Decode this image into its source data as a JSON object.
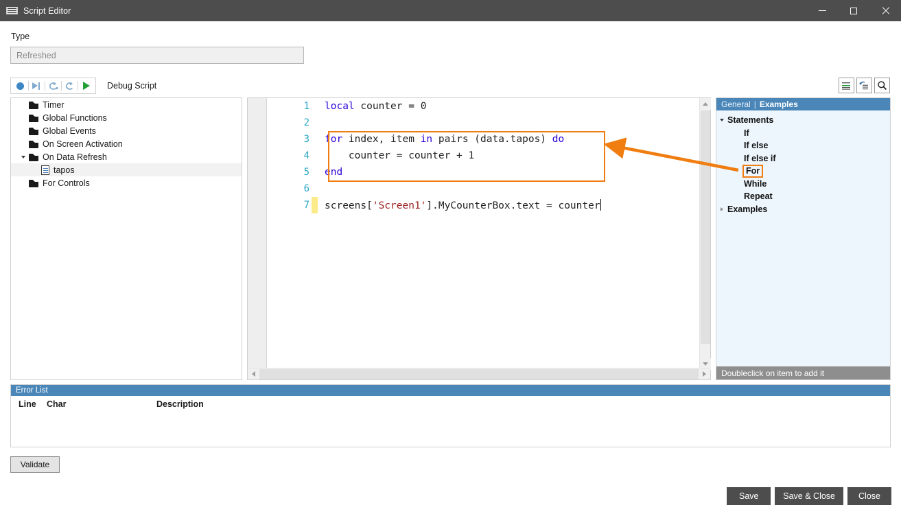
{
  "window": {
    "title": "Script Editor",
    "icon": "script-editor-icon",
    "minimize": "minimize-icon",
    "maximize": "maximize-icon",
    "close": "close-icon"
  },
  "type_field": {
    "label": "Type",
    "value": "Refreshed",
    "placeholder": "Refreshed"
  },
  "debug_toolbar": {
    "label": "Debug Script",
    "buttons": [
      {
        "name": "record-breakpoint-icon",
        "tooltip": "Breakpoint"
      },
      {
        "name": "run-to-end-icon",
        "tooltip": "Run to end"
      },
      {
        "name": "step-over-icon",
        "tooltip": "Step over"
      },
      {
        "name": "step-into-icon",
        "tooltip": "Step into"
      },
      {
        "name": "run-icon",
        "tooltip": "Run"
      }
    ]
  },
  "format_toolbar": {
    "buttons": [
      {
        "name": "format-code-icon",
        "tooltip": "Format"
      },
      {
        "name": "undo-format-icon",
        "tooltip": "Undo format"
      },
      {
        "name": "search-icon",
        "tooltip": "Find"
      }
    ]
  },
  "tree": {
    "items": [
      {
        "label": "Timer",
        "icon": "folder-icon",
        "indent": 0,
        "expander": "none",
        "selected": false
      },
      {
        "label": "Global Functions",
        "icon": "folder-icon",
        "indent": 0,
        "expander": "none",
        "selected": false
      },
      {
        "label": "Global Events",
        "icon": "folder-icon",
        "indent": 0,
        "expander": "none",
        "selected": false
      },
      {
        "label": "On Screen Activation",
        "icon": "folder-icon",
        "indent": 0,
        "expander": "none",
        "selected": false
      },
      {
        "label": "On Data Refresh",
        "icon": "folder-icon",
        "indent": 0,
        "expander": "expanded",
        "selected": false
      },
      {
        "label": "tapos",
        "icon": "document-icon",
        "indent": 1,
        "expander": "none",
        "selected": true
      },
      {
        "label": "For Controls",
        "icon": "folder-icon",
        "indent": 0,
        "expander": "none",
        "selected": false
      }
    ]
  },
  "editor": {
    "lines": [
      {
        "num": "1",
        "changed": false,
        "tokens": [
          {
            "t": "local",
            "c": "kw"
          },
          {
            "t": " counter = ",
            "c": ""
          },
          {
            "t": "0",
            "c": "num"
          }
        ]
      },
      {
        "num": "2",
        "changed": false,
        "tokens": []
      },
      {
        "num": "3",
        "changed": false,
        "tokens": [
          {
            "t": "for",
            "c": "kw"
          },
          {
            "t": " index, item ",
            "c": ""
          },
          {
            "t": "in",
            "c": "kw"
          },
          {
            "t": " pairs (data.tapos) ",
            "c": ""
          },
          {
            "t": "do",
            "c": "kw"
          }
        ]
      },
      {
        "num": "4",
        "changed": false,
        "tokens": [
          {
            "t": "    counter = counter + ",
            "c": ""
          },
          {
            "t": "1",
            "c": "num"
          }
        ]
      },
      {
        "num": "5",
        "changed": false,
        "tokens": [
          {
            "t": "end",
            "c": "kw"
          }
        ]
      },
      {
        "num": "6",
        "changed": false,
        "tokens": []
      },
      {
        "num": "7",
        "changed": true,
        "tokens": [
          {
            "t": "screens[",
            "c": ""
          },
          {
            "t": "'Screen1'",
            "c": "str"
          },
          {
            "t": "].MyCounterBox.text = counter",
            "c": ""
          }
        ],
        "caret": true
      }
    ],
    "plain_text": "local counter = 0\n\nfor index, item in pairs (data.tapos) do\n    counter = counter + 1\nend\n\nscreens['Screen1'].MyCounterBox.text = counter"
  },
  "help_panel": {
    "tabs": [
      {
        "label": "General",
        "active": false
      },
      {
        "label": "|",
        "active": false
      },
      {
        "label": "Examples",
        "active": true
      }
    ],
    "items": [
      {
        "label": "Statements",
        "level": 1,
        "expander": "expanded",
        "bold": true,
        "boxed": false
      },
      {
        "label": "If",
        "level": 2,
        "expander": "none",
        "bold": true,
        "boxed": false
      },
      {
        "label": "If else",
        "level": 2,
        "expander": "none",
        "bold": true,
        "boxed": false
      },
      {
        "label": "If else if",
        "level": 2,
        "expander": "none",
        "bold": true,
        "boxed": false
      },
      {
        "label": "For",
        "level": 2,
        "expander": "none",
        "bold": true,
        "boxed": true
      },
      {
        "label": "While",
        "level": 2,
        "expander": "none",
        "bold": true,
        "boxed": false
      },
      {
        "label": "Repeat",
        "level": 2,
        "expander": "none",
        "bold": true,
        "boxed": false
      },
      {
        "label": "Examples",
        "level": 1,
        "expander": "collapsed",
        "bold": true,
        "boxed": false
      }
    ],
    "status": "Doubleclick on item to add it"
  },
  "error_list": {
    "title": "Error List",
    "columns": [
      "Line",
      "Char",
      "Description"
    ],
    "rows": []
  },
  "buttons": {
    "validate": "Validate",
    "save": "Save",
    "save_and_close": "Save & Close",
    "close": "Close"
  },
  "annotation": {
    "color": "#f07d10",
    "from": "For",
    "to": "for-loop-code-block"
  }
}
